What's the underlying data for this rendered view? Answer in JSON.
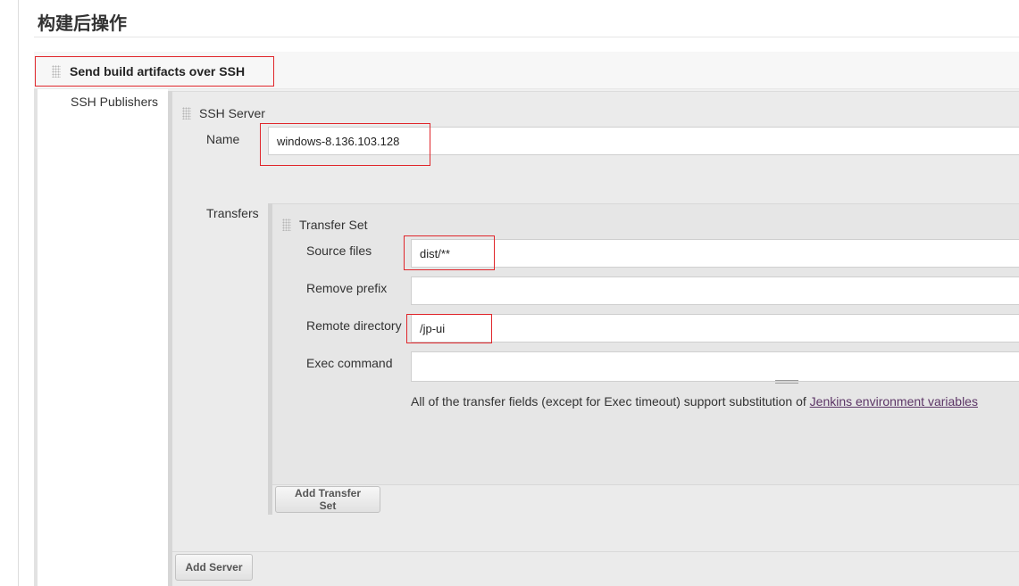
{
  "page": {
    "section_title": "构建后操作"
  },
  "publisher": {
    "title": "Send build artifacts over SSH",
    "ssh_publishers_label": "SSH Publishers"
  },
  "server": {
    "title": "SSH Server",
    "name_label": "Name",
    "name_value": "windows-8.136.103.128",
    "transfers_label": "Transfers",
    "add_server_label": "Add Server"
  },
  "transfer_set": {
    "title": "Transfer Set",
    "source_files_label": "Source files",
    "source_files_value": "dist/**",
    "remove_prefix_label": "Remove prefix",
    "remove_prefix_value": "",
    "remote_directory_label": "Remote directory",
    "remote_directory_value": "/jp-ui",
    "exec_command_label": "Exec command",
    "exec_command_value": "",
    "help_text": "All of the transfer fields (except for Exec timeout) support substitution of ",
    "help_link": "Jenkins environment variables",
    "add_transfer_set_label": "Add Transfer Set"
  },
  "colors": {
    "highlight": "#e0262b",
    "link": "#5c3566"
  }
}
